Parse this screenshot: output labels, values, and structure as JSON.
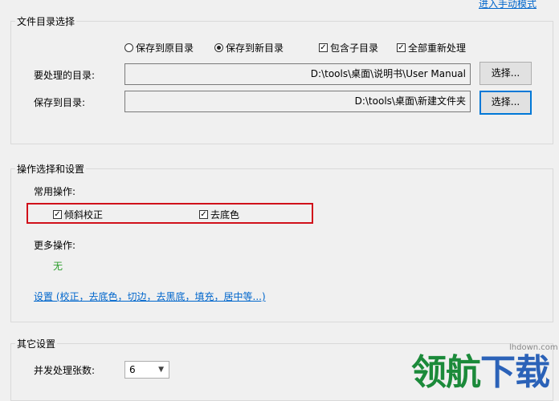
{
  "top_link": "进入手动模式",
  "file_group": {
    "title": "文件目录选择",
    "radio_original": "保存到原目录",
    "radio_new": "保存到新目录",
    "check_subdir": "包含子目录",
    "check_reprocess": "全部重新处理",
    "source_label": "要处理的目录:",
    "source_value": "D:\\tools\\桌面\\说明书\\User Manual",
    "dest_label": "保存到目录:",
    "dest_value": "D:\\tools\\桌面\\新建文件夹",
    "choose_label": "选择..."
  },
  "ops_group": {
    "title": "操作选择和设置",
    "common_label": "常用操作:",
    "check_deskew": "倾斜校正",
    "check_remove_bg": "去底色",
    "more_label": "更多操作:",
    "more_value": "无",
    "settings_link": "设置 (校正，去底色，切边，去黑底，填充，居中等...)",
    "colors": {
      "more_value": "#2a9d2a",
      "highlight": "#d0101a"
    }
  },
  "other_group": {
    "title": "其它设置",
    "concurrency_label": "并发处理张数:",
    "concurrency_value": "6"
  },
  "watermark": {
    "domain": "lhdown.com",
    "brand_text": "领航下载"
  }
}
